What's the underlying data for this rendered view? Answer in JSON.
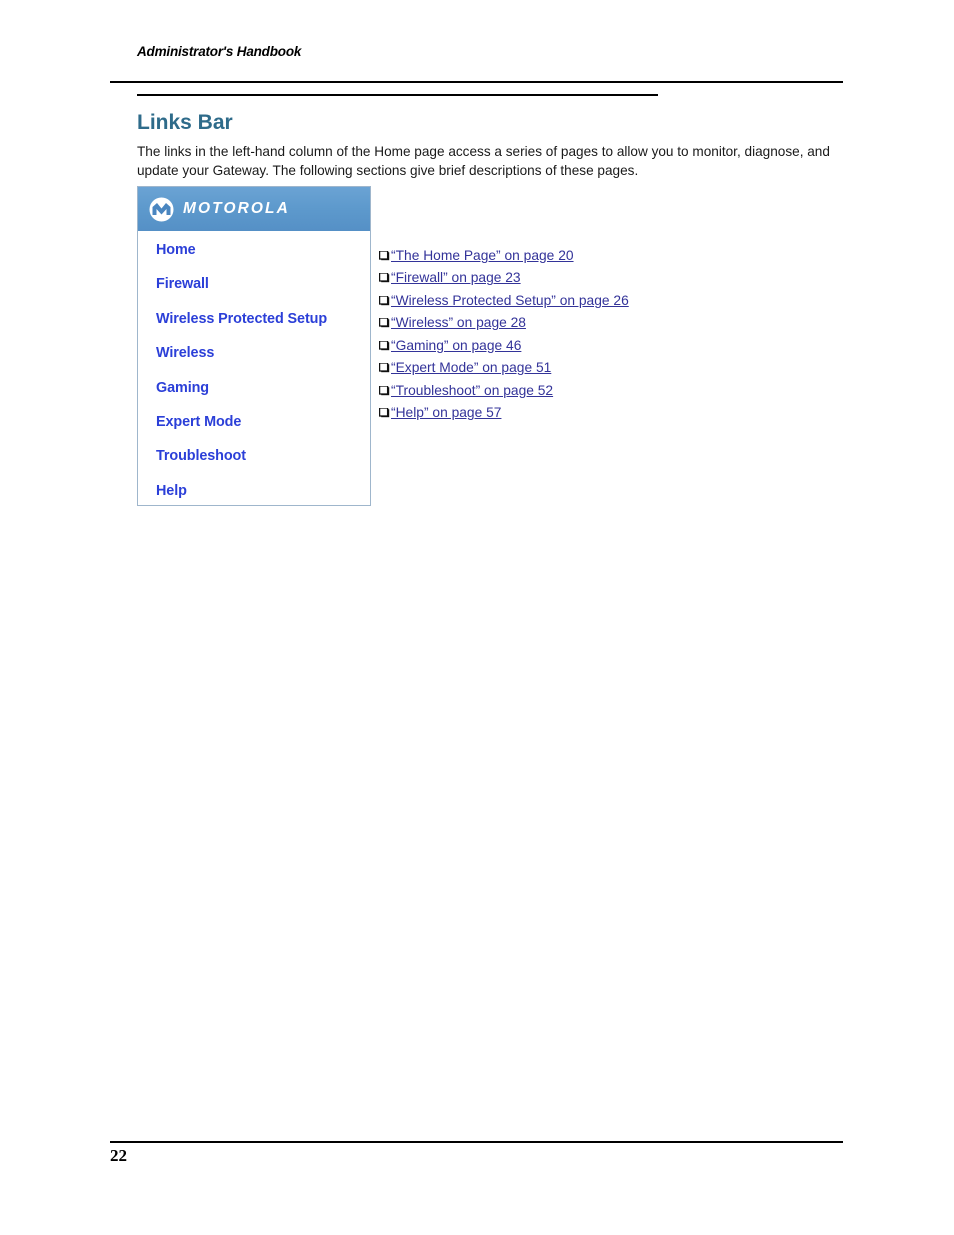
{
  "document": {
    "running_header": "Administrator's Handbook",
    "section_heading": "Links Bar",
    "intro_paragraph": "The links in the left-hand column of the Home page access a series of pages to allow you to monitor, diagnose, and update your Gateway. The following sections give brief descriptions of these pages.",
    "page_number": "22"
  },
  "links_bar_panel": {
    "brand": "MOTOROLA",
    "nav_items": [
      {
        "label": "Home"
      },
      {
        "label": "Firewall"
      },
      {
        "label": "Wireless Protected Setup"
      },
      {
        "label": "Wireless"
      },
      {
        "label": "Gaming"
      },
      {
        "label": "Expert Mode"
      },
      {
        "label": "Troubleshoot"
      },
      {
        "label": "Help"
      }
    ]
  },
  "cross_references": [
    {
      "label": "“The Home Page” on page 20"
    },
    {
      "label": "“Firewall” on page 23"
    },
    {
      "label": "“Wireless Protected Setup” on page 26"
    },
    {
      "label": "“Wireless” on page 28"
    },
    {
      "label": "“Gaming” on page 46"
    },
    {
      "label": "“Expert Mode” on page 51"
    },
    {
      "label": "“Troubleshoot” on page 52"
    },
    {
      "label": "“Help” on page 57"
    }
  ],
  "colors": {
    "heading": "#2e6b8a",
    "nav_link": "#2b3fd8",
    "xref_link": "#333399",
    "panel_header_blue": "#5e9acd",
    "panel_border": "#9fb6cc"
  }
}
